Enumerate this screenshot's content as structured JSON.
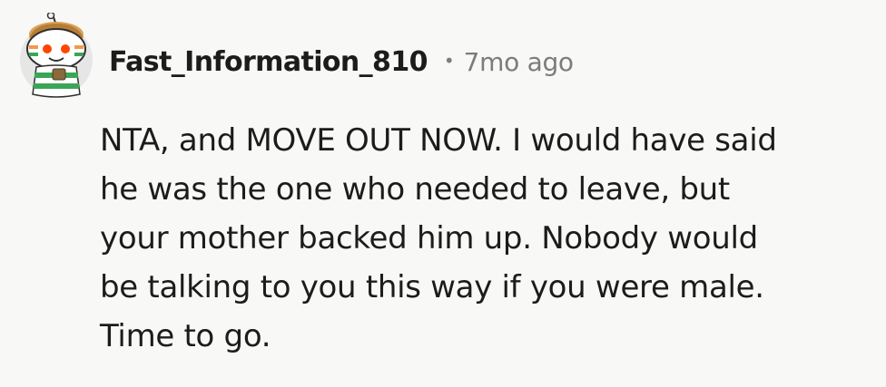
{
  "comment": {
    "username": "Fast_Information_810",
    "separator": "•",
    "timestamp": "7mo ago",
    "avatar_icon": "snoo-avatar-icon",
    "body_lines": [
      "NTA, and MOVE OUT NOW. I would have said",
      "he was the one who needed to leave, but",
      "your mother backed him up. Nobody would",
      "be talking to you this way if you were male.",
      "Time to go."
    ]
  },
  "colors": {
    "background": "#f8f8f6",
    "text": "#1c1c1c",
    "meta": "#7c7c7c"
  }
}
